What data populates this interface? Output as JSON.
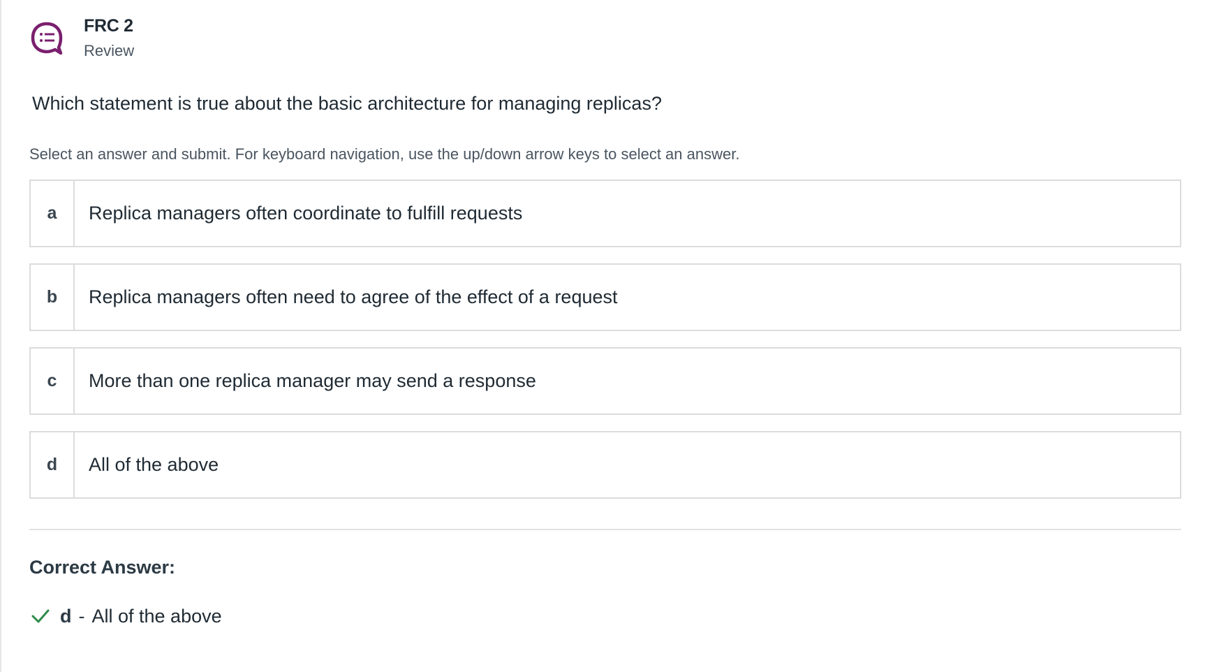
{
  "header": {
    "icon": "quiz-chat-icon",
    "title": "FRC 2",
    "subtitle": "Review"
  },
  "question": {
    "text": "Which statement is true about the basic architecture for managing replicas?",
    "instructions": "Select an answer and submit. For keyboard navigation, use the up/down arrow keys to select an answer."
  },
  "options": [
    {
      "letter": "a",
      "text": "Replica managers often coordinate to fulfill requests"
    },
    {
      "letter": "b",
      "text": "Replica managers often need to agree of the effect of a request"
    },
    {
      "letter": "c",
      "text": "More than one replica manager may send a response"
    },
    {
      "letter": "d",
      "text": "All of the above"
    }
  ],
  "correct_answer": {
    "heading": "Correct Answer:",
    "icon": "checkmark-icon",
    "letter": "d",
    "separator": "-",
    "text": "All of the above"
  },
  "colors": {
    "brand_icon": "#7a1f6e",
    "check": "#2e8b4a",
    "border": "#dcdcdc"
  }
}
